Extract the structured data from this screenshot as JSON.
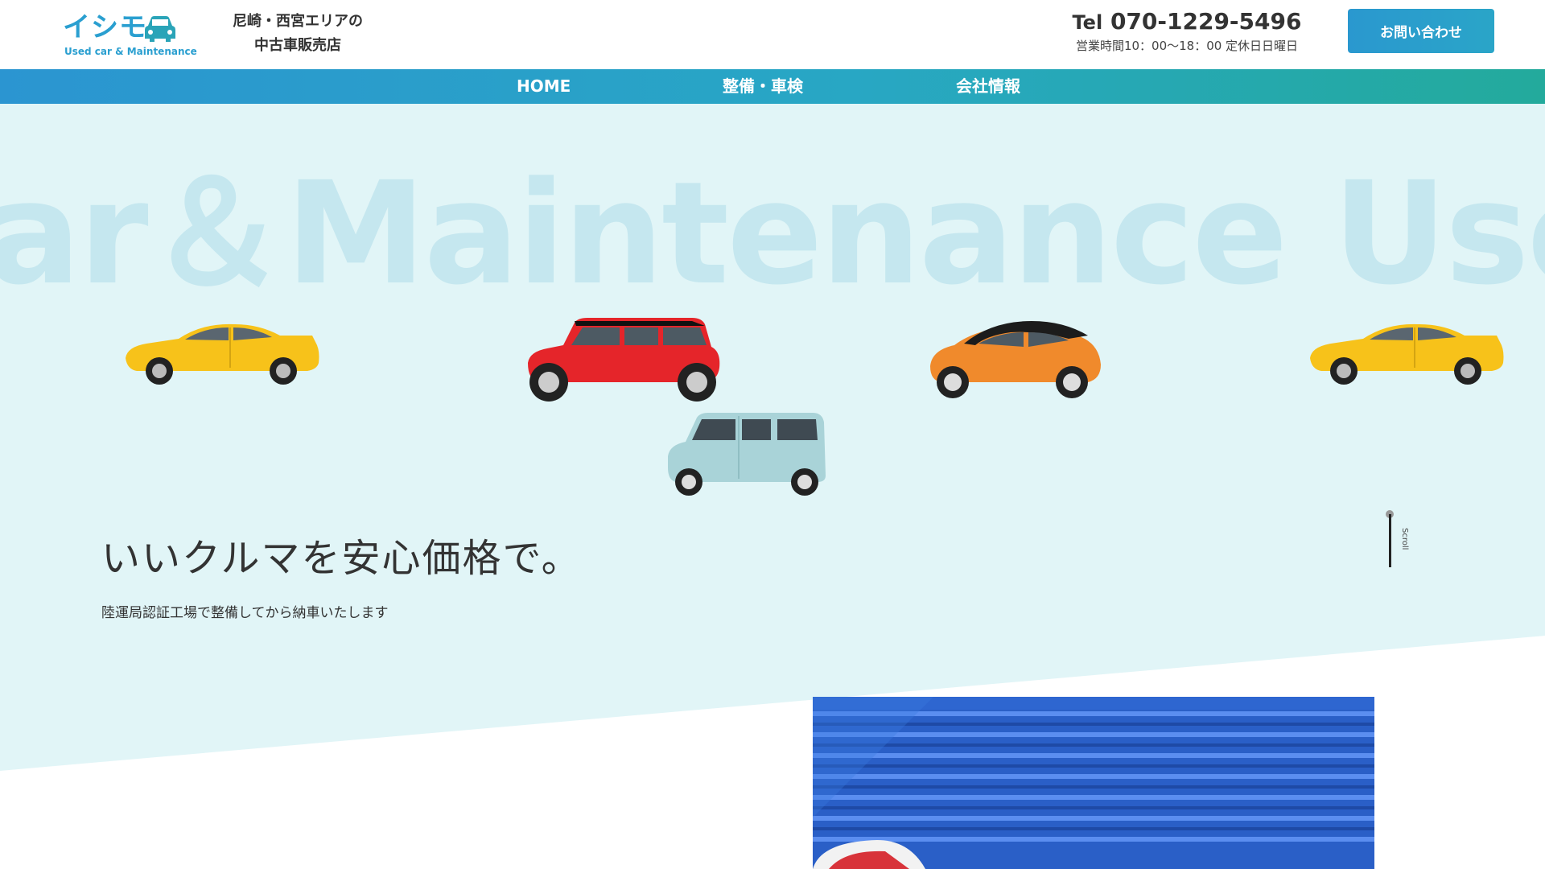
{
  "header": {
    "logo_text": "イシモ",
    "logo_sub": "Used car & Maintenance",
    "tagline_line1": "尼崎・西宮エリアの",
    "tagline_line2": "中古車販売店",
    "tel_prefix": "Tel",
    "tel_number": "070-1229-5496",
    "hours": "営業時間10：00〜18：00 定休日日曜日",
    "contact_label": "お問い合わせ"
  },
  "nav": {
    "items": [
      {
        "label": "HOME"
      },
      {
        "label": "整備・車検"
      },
      {
        "label": "会社情報"
      }
    ]
  },
  "hero": {
    "bg_text": "ar＆Maintenance Usedcar",
    "headline": "いいクルマを安心価格で。",
    "subline": "陸運局認証工場で整備してから納車いたします",
    "scroll_label": "Scroll"
  },
  "colors": {
    "brand": "#2a9fd0",
    "nav_start": "#2b95d1",
    "nav_end": "#23aa9c",
    "hero_bg": "#e1f5f7",
    "bg_text": "#c5e7ef"
  }
}
